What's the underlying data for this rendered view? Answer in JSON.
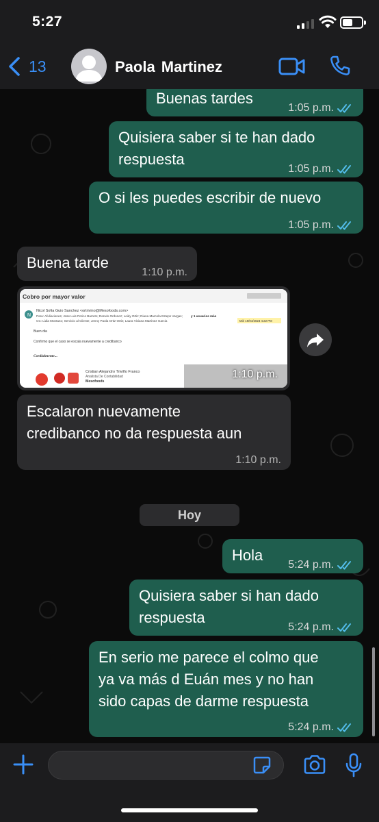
{
  "status_bar": {
    "time": "5:27",
    "battery_level": 0.55
  },
  "header": {
    "back_count": "13",
    "contact_name": "Paola  Martinez"
  },
  "messages": [
    {
      "dir": "out",
      "lines": [
        "Buenas tardes"
      ],
      "time": "1:05 p.m.",
      "read": true
    },
    {
      "dir": "out",
      "lines": [
        "Quisiera saber si te han dado",
        "respuesta"
      ],
      "time": "1:05 p.m.",
      "read": true
    },
    {
      "dir": "out",
      "lines": [
        "O si les puedes escribir de nuevo"
      ],
      "time": "1:05 p.m.",
      "read": true
    },
    {
      "dir": "in",
      "lines": [
        "Buena tarde"
      ],
      "time": "1:10 p.m."
    },
    {
      "dir": "in",
      "type": "image",
      "time": "1:10 p.m."
    },
    {
      "dir": "in",
      "lines": [
        "Escalaron nuevamente",
        "credibanco no da respuesta aun"
      ],
      "time": "1:10 p.m."
    },
    {
      "dir": "out",
      "lines": [
        "Hola"
      ],
      "time": "5:24 p.m.",
      "read": true
    },
    {
      "dir": "out",
      "lines": [
        "Quisiera saber si han dado",
        "respuesta"
      ],
      "time": "5:24 p.m.",
      "read": true
    },
    {
      "dir": "out",
      "lines": [
        "En serio me parece el colmo que",
        "ya va más d Euán mes y no han",
        "sido capas de darme respuesta"
      ],
      "time": "5:24 p.m.",
      "read": true
    }
  ],
  "day_separator": "Hoy",
  "email_screenshot": {
    "subject": "Cobro por mayor valor",
    "sender": "Nicol Sofia Guio Sanchez <ortrivino@Mesofoods.com>",
    "to_line": "Para: Afuliaciones; Jose Luis Perico Barreto; Darwin Ordonez; Leidy Ortiz; Diana Marcela Esteps Vargas;",
    "to_more": "y 1 usuarios más",
    "cc_line": "CC: Lidia Montano; Servicio al Cliente; Jenny Paola Ortiz Ortiz; Laura Viviana Martinez Garcia",
    "date": "Mié 19/04/2023 4:22 PM",
    "greeting": "Buen dia",
    "body": "Confirmo que el caso se escala nuevamente a credibanco",
    "closing": "Cordialmente...",
    "sig_name": "Cristian Alejandro Triviño Franco",
    "sig_role": "Analista De Contabilidad",
    "sig_company": "Mesofoods",
    "avatar_letter": "N"
  },
  "colors": {
    "outgoing_bubble": "#1f5e4e",
    "incoming_bubble": "#2c2c2e",
    "read_ticks": "#53bdeb",
    "accent": "#3a8ff7"
  },
  "icons": [
    "chevron-left-icon",
    "avatar-placeholder-icon",
    "video-call-icon",
    "phone-icon",
    "forward-icon",
    "plus-icon",
    "sticker-icon",
    "camera-icon",
    "mic-icon"
  ]
}
